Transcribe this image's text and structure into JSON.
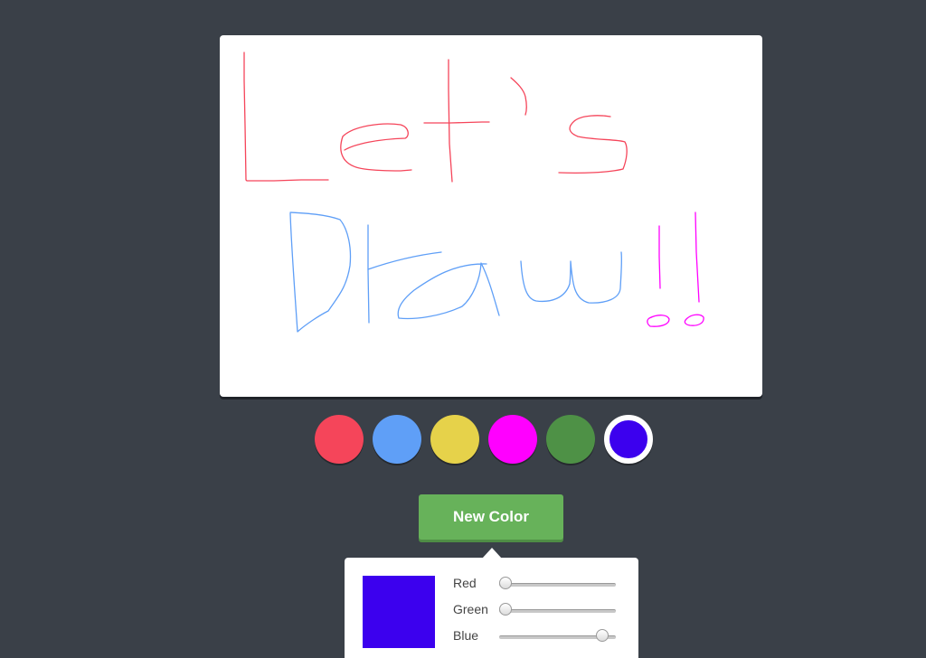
{
  "palette": {
    "colors": [
      "#f5455a",
      "#5f9ff7",
      "#e6d24a",
      "#ff00ff",
      "#4e9146",
      "#3c00ee"
    ],
    "selected_index": 5
  },
  "new_color_button": {
    "label": "New Color"
  },
  "color_picker": {
    "preview_color": "#3c00ee",
    "sliders": [
      {
        "label": "Red",
        "value": 0
      },
      {
        "label": "Green",
        "value": 0
      },
      {
        "label": "Blue",
        "value": 238
      }
    ],
    "max": 255
  }
}
